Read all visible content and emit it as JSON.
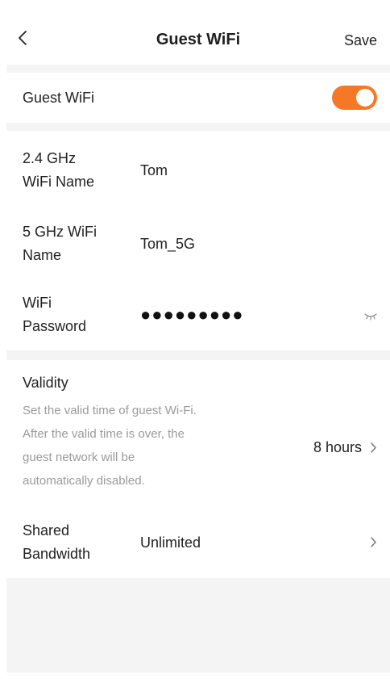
{
  "header": {
    "title": "Guest WiFi",
    "save_label": "Save",
    "back_icon": "chevron-left-icon"
  },
  "guest_wifi": {
    "label": "Guest WiFi",
    "enabled": true,
    "accent_color": "#f47826"
  },
  "fields": {
    "ssid_24": {
      "label_line1": "2.4 GHz",
      "label_line2": "WiFi Name",
      "value": "Tom"
    },
    "ssid_5": {
      "label_line1": "5 GHz WiFi",
      "label_line2": "Name",
      "value": "Tom_5G"
    },
    "password": {
      "label_line1": "WiFi",
      "label_line2": "Password",
      "value": "●●●●●●●●●",
      "visibility_icon": "eye-closed-icon"
    }
  },
  "validity": {
    "title": "Validity",
    "description": [
      "Set the valid time of guest Wi-Fi.",
      "After the valid time is over, the",
      "guest network will be",
      "automatically disabled."
    ],
    "value": "8 hours"
  },
  "bandwidth": {
    "label_line1": "Shared",
    "label_line2": "Bandwidth",
    "value": "Unlimited"
  }
}
